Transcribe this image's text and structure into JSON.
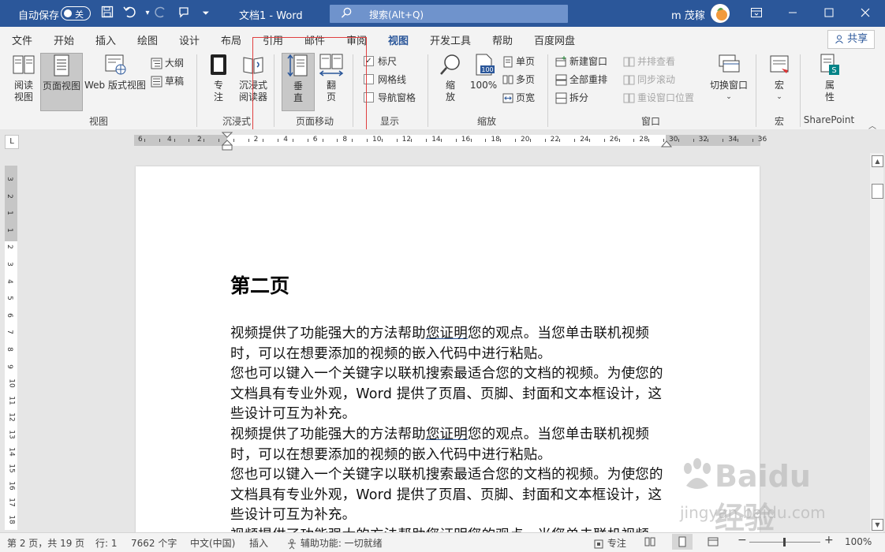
{
  "titlebar": {
    "autosave_label": "自动保存",
    "autosave_state": "关",
    "doc_title": "文档1  -  Word",
    "search_placeholder": "搜索(Alt+Q)",
    "user_name": "m 茂稼"
  },
  "tabs": [
    "文件",
    "开始",
    "插入",
    "绘图",
    "设计",
    "布局",
    "引用",
    "邮件",
    "审阅",
    "视图",
    "开发工具",
    "帮助",
    "百度网盘"
  ],
  "active_tab": "视图",
  "share_label": "共享",
  "ribbon": {
    "views": {
      "group": "视图",
      "read_mode": [
        "阅读",
        "视图"
      ],
      "print_layout": "页面视图",
      "web_layout": [
        "Web 版式视图"
      ],
      "outline": "大纲",
      "draft": "草稿"
    },
    "immersive": {
      "group": "沉浸式",
      "focus": [
        "专",
        "注"
      ],
      "immersive_reader": [
        "沉浸式",
        "阅读器"
      ]
    },
    "page_movement": {
      "group": "页面移动",
      "vertical": [
        "垂",
        "直"
      ],
      "side_to_side": [
        "翻",
        "页"
      ]
    },
    "show": {
      "group": "显示",
      "ruler": "标尺",
      "ruler_checked": true,
      "gridlines": "网格线",
      "nav_pane": "导航窗格"
    },
    "zoom": {
      "group": "缩放",
      "zoom": [
        "缩",
        "放"
      ],
      "hundred": "100%",
      "one_page": "单页",
      "multiple_pages": "多页",
      "page_width": "页宽",
      "zoom_icon_value": "100"
    },
    "window": {
      "group": "窗口",
      "new_window": "新建窗口",
      "arrange_all": "全部重排",
      "split": "拆分",
      "side_by_side": "并排查看",
      "sync_scroll": "同步滚动",
      "reset_position": "重设窗口位置",
      "switch_windows": "切换窗口"
    },
    "macros": {
      "group": "宏",
      "macros": "宏"
    },
    "sharepoint": {
      "group": "SharePoint",
      "properties": [
        "属",
        "性"
      ]
    }
  },
  "ruler": {
    "labels_left": [
      "6",
      "4",
      "2"
    ],
    "labels_right": [
      "2",
      "4",
      "6",
      "8",
      "10",
      "12",
      "14",
      "16",
      "18",
      "20",
      "22",
      "24",
      "26",
      "28",
      "30",
      "32",
      "34",
      "36"
    ],
    "tab_selector": "L",
    "vertical_labels": [
      "3",
      "2",
      "1",
      "1",
      "2",
      "3",
      "4",
      "5",
      "6",
      "7",
      "8",
      "9",
      "10",
      "11",
      "12",
      "13",
      "14",
      "15",
      "16",
      "17",
      "18"
    ]
  },
  "document": {
    "heading": "第二页",
    "paragraphs": [
      {
        "before": "视频提供了功能强大的方法帮助",
        "underlined": "您证明",
        "after": "您的观点。当您单击联机视频时，可以在想要添加的视频的嵌入代码中进行粘贴。"
      },
      {
        "before": "您也可以键入一个关键字以联机搜索最适合您的文档的视频。为使您的文档具有专业外观，Word 提供了页眉、页脚、封面和文本框设计，这些设计可互为补充。",
        "underlined": "",
        "after": ""
      },
      {
        "before": "视频提供了功能强大的方法帮助",
        "underlined": "您证明",
        "after": "您的观点。当您单击联机视频时，可以在想要添加的视频的嵌入代码中进行粘贴。"
      },
      {
        "before": "您也可以键入一个关键字以联机搜索最适合您的文档的视频。为使您的文档具有专业外观，Word 提供了页眉、页脚、封面和文本框设计，这些设计可互为补充。",
        "underlined": "",
        "after": ""
      },
      {
        "before": "视频提供了功能强大的方法帮助您证明您的观点。当您单击联机视频",
        "underlined": "",
        "after": ""
      }
    ]
  },
  "statusbar": {
    "page": "第 2 页，共 19 页",
    "line": "行: 1",
    "words": "7662 个字",
    "language": "中文(中国)",
    "mode": "插入",
    "accessibility": "辅助功能: 一切就绪",
    "focus": "专注",
    "zoom_level": "100%"
  },
  "watermark": {
    "brand": "Baidu经验",
    "url": "jingyan.baidu.com"
  },
  "colors": {
    "titlebar": "#2b579a",
    "ribbon": "#f3f3f3",
    "highlight_box": "#e04040"
  }
}
